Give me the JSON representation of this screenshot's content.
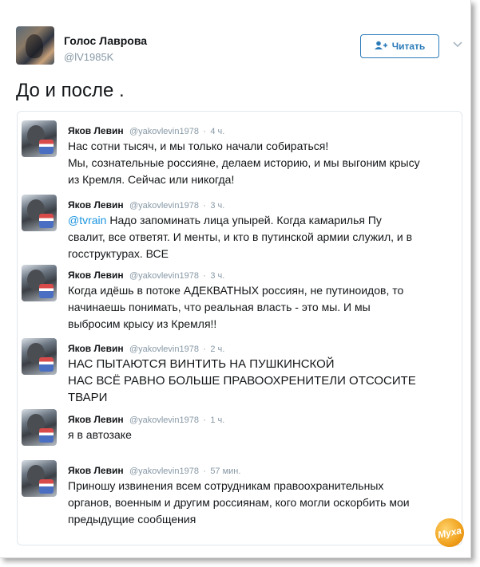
{
  "author": {
    "name": "Голос Лаврова",
    "handle": "@lV1985K"
  },
  "follow_button": {
    "label": "Читать",
    "icon": "add-user-icon"
  },
  "menu": {
    "icon": "chevron-down-icon"
  },
  "tweet": {
    "text": "До и после ."
  },
  "quoted_tweets": [
    {
      "name": "Яков Левин",
      "handle": "@yakovlevin1978",
      "time": "4 ч.",
      "lines": [
        "Нас сотни тысяч, и мы только начали собираться!",
        "Мы, сознательные россияне, делаем историю, и мы выгоним крысу",
        "из Кремля. Сейчас или никогда!"
      ]
    },
    {
      "name": "Яков Левин",
      "handle": "@yakovlevin1978",
      "time": "3 ч.",
      "mention": "@tvrain",
      "lines": [
        "Надо запоминать лица упырей. Когда камарилья Пу",
        "свалит, все ответят. И менты, и кто в путинской армии служил, и в",
        "госструктурах. ВСЕ"
      ]
    },
    {
      "name": "Яков Левин",
      "handle": "@yakovlevin1978",
      "time": "3 ч.",
      "lines": [
        "Когда идёшь в потоке АДЕКВАТНЫХ россиян, не путиноидов, то",
        "начинаешь понимать, что реальная власть - это мы. И мы",
        "выбросим крысу из Кремля!!"
      ]
    },
    {
      "name": "Яков Левин",
      "handle": "@yakovlevin1978",
      "time": "2 ч.",
      "lines": [
        "НАС ПЫТАЮТСЯ ВИНТИТЬ НА ПУШКИНСКОЙ",
        "НАС ВСЁ РАВНО БОЛЬШЕ ПРАВООХРЕНИТЕЛИ ОТСОСИТЕ",
        "ТВАРИ"
      ]
    },
    {
      "name": "Яков Левин",
      "handle": "@yakovlevin1978",
      "time": "1 ч.",
      "lines": [
        "я в автозаке"
      ]
    },
    {
      "name": "Яков Левин",
      "handle": "@yakovlevin1978",
      "time": "57 мин.",
      "lines": [
        "Приношу извинения всем сотрудникам правоохранительных",
        "органов, военным и другим россиянам, кого могли оскорбить мои",
        "предыдущие сообщения"
      ]
    }
  ],
  "watermark": {
    "text": "Муха"
  }
}
